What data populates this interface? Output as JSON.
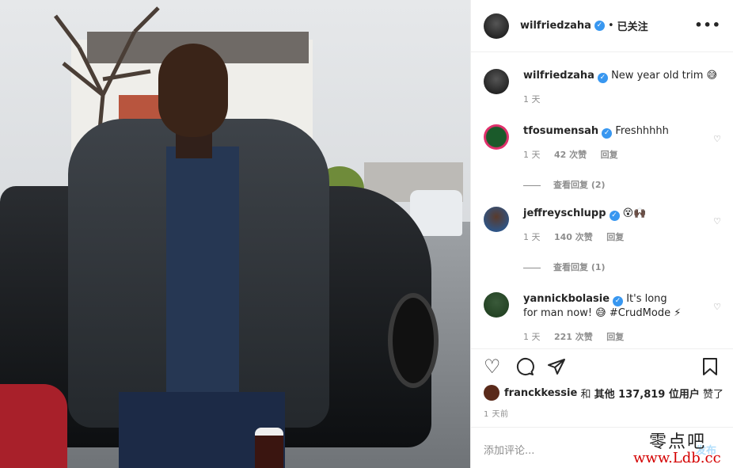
{
  "header": {
    "username": "wilfriedzaha",
    "separator": "•",
    "follow_status": "已关注",
    "more": "•••"
  },
  "caption": {
    "username": "wilfriedzaha",
    "text": "New year old trim 😅",
    "time": "1 天"
  },
  "comments": [
    {
      "username": "tfosumensah",
      "text": "Freshhhhh",
      "time": "1 天",
      "likes": "42 次赞",
      "reply": "回复",
      "view_replies": "查看回复 (2)"
    },
    {
      "username": "jeffreyschlupp",
      "text": "😵🙌🏿",
      "time": "1 天",
      "likes": "140 次赞",
      "reply": "回复",
      "view_replies": "查看回复 (1)"
    },
    {
      "username": "yannickbolasie",
      "text": "It's long for man now! 😅 #CrudMode ⚡",
      "time": "1 天",
      "likes": "221 次赞",
      "reply": "回复"
    }
  ],
  "likes": {
    "user": "franckkessie",
    "and": "和",
    "others": "其他 137,819 位用户",
    "liked": "赞了"
  },
  "posted": "1 天前",
  "add_comment": {
    "placeholder": "添加评论...",
    "post": "发布"
  },
  "watermark": {
    "line1": "零点吧",
    "line2": "www.Ldb.cc"
  },
  "colors": {
    "verified": "#3897f0",
    "muted": "#8e8e8e",
    "post_disabled": "#b2dffc"
  },
  "icons": [
    "verified-badge-icon",
    "heart-icon",
    "comment-icon",
    "share-icon",
    "bookmark-icon",
    "more-icon"
  ]
}
